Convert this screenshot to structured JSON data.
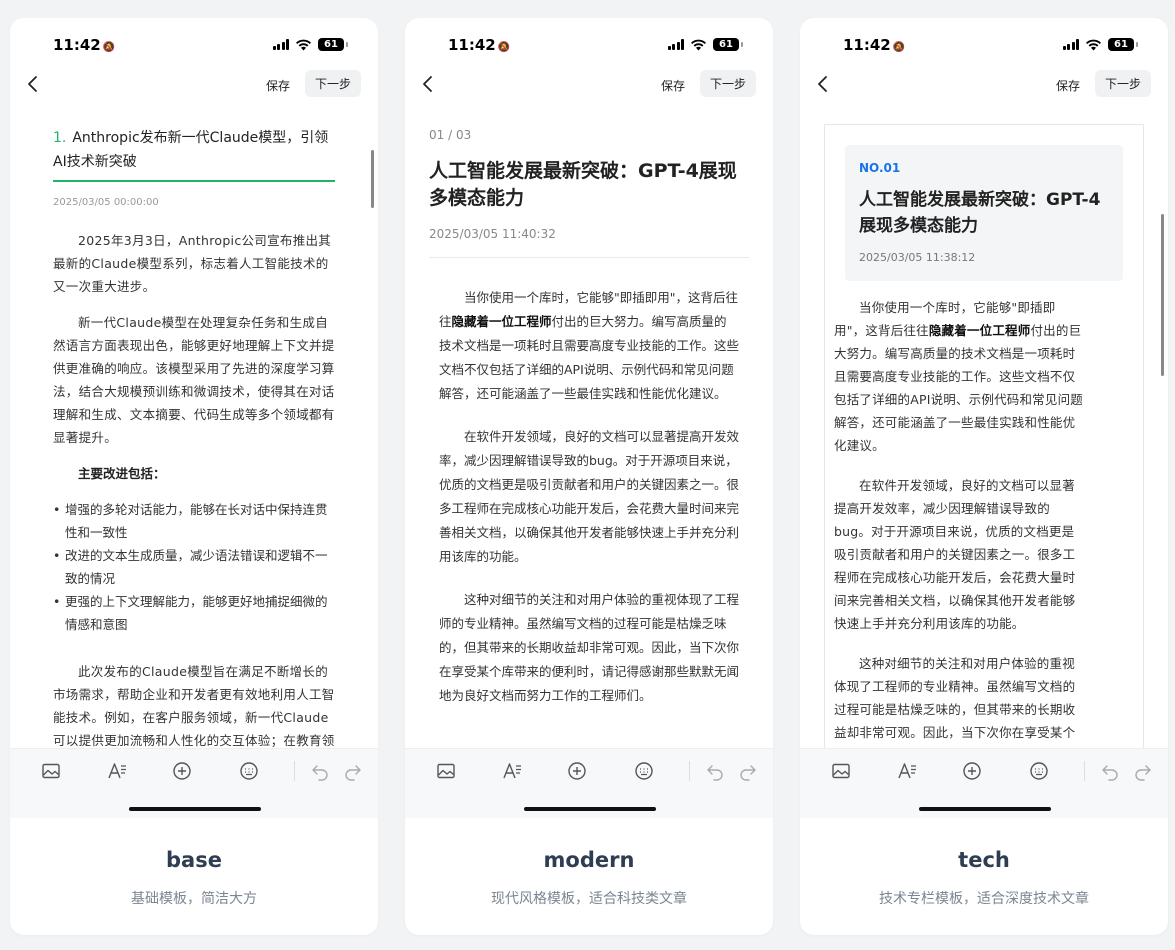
{
  "common": {
    "time": "11:42",
    "battery": "61",
    "save_label": "保存",
    "next_label": "下一步"
  },
  "cards": [
    {
      "name": "base",
      "desc": "基础模板，简洁大方",
      "article": {
        "number": "1.",
        "title": "Anthropic发布新一代Claude模型，引领AI技术新突破",
        "date": "2025/03/05 00:00:00",
        "paragraphs": [
          "2025年3月3日，Anthropic公司宣布推出其最新的Claude模型系列，标志着人工智能技术的又一次重大进步。",
          "新一代Claude模型在处理复杂任务和生成自然语言方面表现出色，能够更好地理解上下文并提供更准确的响应。该模型采用了先进的深度学习算法，结合大规模预训练和微调技术，使得其在对话理解和生成、文本摘要、代码生成等多个领域都有显著提升。"
        ],
        "subheading": "主要改进包括：",
        "bullets": [
          "增强的多轮对话能力，能够在长对话中保持连贯性和一致性",
          "改进的文本生成质量，减少语法错误和逻辑不一致的情况",
          "更强的上下文理解能力，能够更好地捕捉细微的情感和意图"
        ],
        "closing": "此次发布的Claude模型旨在满足不断增长的市场需求，帮助企业和开发者更有效地利用人工智能技术。例如，在客户服务领域，新一代Claude可以提供更加流畅和人性化的交互体验；在教育领"
      }
    },
    {
      "name": "modern",
      "desc": "现代风格模板，适合科技类文章",
      "article": {
        "page": "01 / 03",
        "title": "人工智能发展最新突破：GPT-4展现多模态能力",
        "date": "2025/03/05 11:40:32",
        "p1_before": "当你使用一个库时，它能够\"即插即用\"，这背后往往",
        "p1_bold": "隐藏着一位工程师",
        "p1_after": "付出的巨大努力。编写高质量的技术文档是一项耗时且需要高度专业技能的工作。这些文档不仅包括了详细的API说明、示例代码和常见问题解答，还可能涵盖了一些最佳实践和性能优化建议。",
        "p2": "在软件开发领域，良好的文档可以显著提高开发效率，减少因理解错误导致的bug。对于开源项目来说，优质的文档更是吸引贡献者和用户的关键因素之一。很多工程师在完成核心功能开发后，会花费大量时间来完善相关文档，以确保其他开发者能够快速上手并充分利用该库的功能。",
        "p3": "这种对细节的关注和对用户体验的重视体现了工程师的专业精神。虽然编写文档的过程可能是枯燥乏味的，但其带来的长期收益却非常可观。因此，当下次你在享受某个库带来的便利时，请记得感谢那些默默无闻地为良好文档而努力工作的工程师们。"
      }
    },
    {
      "name": "tech",
      "desc": "技术专栏模板，适合深度技术文章",
      "article": {
        "badge": "NO.01",
        "title": "人工智能发展最新突破：GPT-4展现多模态能力",
        "date": "2025/03/05 11:38:12",
        "p1_before": "当你使用一个库时，它能够\"即插即用\"，这背后往往",
        "p1_bold": "隐藏着一位工程师",
        "p1_after": "付出的巨大努力。编写高质量的技术文档是一项耗时且需要高度专业技能的工作。这些文档不仅包括了详细的API说明、示例代码和常见问题解答，还可能涵盖了一些最佳实践和性能优化建议。",
        "p2": "在软件开发领域，良好的文档可以显著提高开发效率，减少因理解错误导致的bug。对于开源项目来说，优质的文档更是吸引贡献者和用户的关键因素之一。很多工程师在完成核心功能开发后，会花费大量时间来完善相关文档，以确保其他开发者能够快速上手并充分利用该库的功能。",
        "p3": "这种对细节的关注和对用户体验的重视体现了工程师的专业精神。虽然编写文档的过程可能是枯燥乏味的，但其带来的长期收益却非常可观。因此，当下次你在享受某个库带来的便利时，请记得感谢那些默默无闻"
      }
    }
  ],
  "icons": {
    "toolbar": [
      "image-icon",
      "font-style-icon",
      "add-icon",
      "emoji-icon",
      "undo-icon",
      "redo-icon"
    ],
    "status": [
      "bell-slash-icon",
      "signal-icon",
      "wifi-icon",
      "battery-icon"
    ]
  },
  "colors": {
    "base_accent": "#22b36a",
    "tech_accent": "#1a73e8",
    "template_name": "#2f3d52"
  }
}
